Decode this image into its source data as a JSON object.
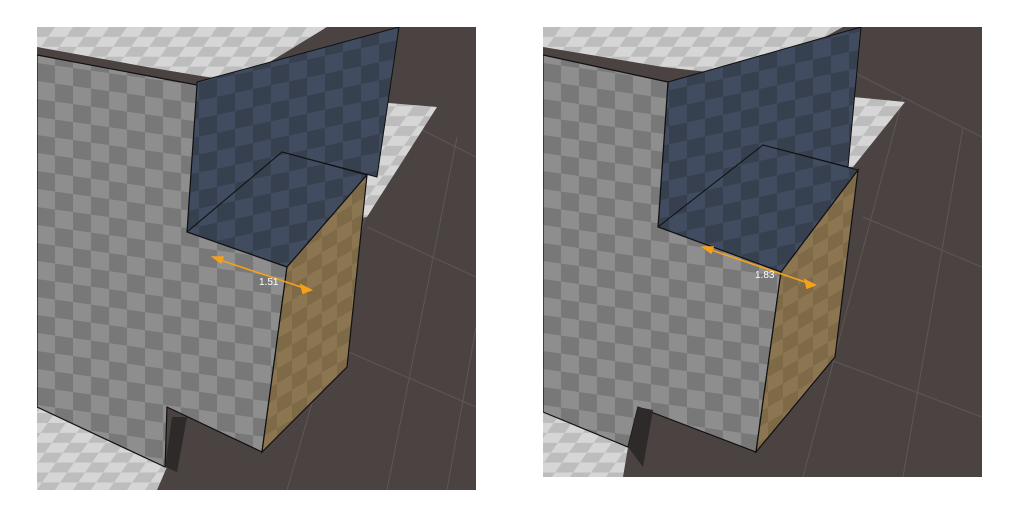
{
  "viewports": [
    {
      "name": "left",
      "measurement": "1.51"
    },
    {
      "name": "right",
      "measurement": "1.83"
    }
  ],
  "colors": {
    "ground": "#4a4341",
    "grid_line": "#5e5754",
    "checker_light": "#d6d6d6",
    "checker_dark": "#b9b9b9",
    "wall_light": "#8e8e8e",
    "wall_dark": "#7b7b7b",
    "shadow_face": "#3d475a",
    "selected_face": "#8a7450",
    "arrow": "#f5a11a",
    "edge": "#101010"
  },
  "icons": [
    "measure-arrow-icon"
  ]
}
